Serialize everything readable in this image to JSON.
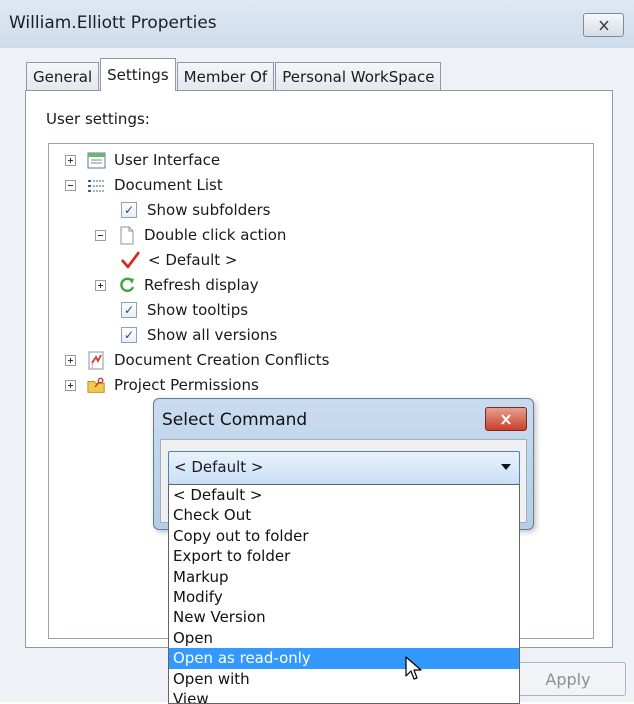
{
  "window": {
    "title": "William.Elliott Properties",
    "close_icon": "close-icon",
    "tabs": [
      {
        "label": "General",
        "active": false
      },
      {
        "label": "Settings",
        "active": true
      },
      {
        "label": "Member Of",
        "active": false
      },
      {
        "label": "Personal WorkSpace",
        "active": false
      }
    ],
    "apply_label": "Apply"
  },
  "settings": {
    "label": "User settings:",
    "tree": [
      {
        "label": "User Interface",
        "icon": "window-icon",
        "expander": "plus"
      },
      {
        "label": "Document List",
        "icon": "list-icon",
        "expander": "minus"
      },
      {
        "label": "Show subfolders",
        "checked": true
      },
      {
        "label": "Double click action",
        "icon": "document-icon",
        "expander": "minus"
      },
      {
        "label": "< Default >",
        "icon": "checkmark-icon"
      },
      {
        "label": "Refresh display",
        "icon": "refresh-icon",
        "expander": "plus"
      },
      {
        "label": "Show tooltips",
        "checked": true
      },
      {
        "label": "Show all versions",
        "checked": true
      },
      {
        "label": "Document Creation Conflicts",
        "icon": "conflict-icon",
        "expander": "plus"
      },
      {
        "label": "Project Permissions",
        "icon": "folder-key-icon",
        "expander": "plus"
      }
    ]
  },
  "dialog": {
    "title": "Select Command",
    "selected_value": "< Default >",
    "options": [
      "< Default >",
      "Check Out",
      "Copy out to folder",
      "Export to folder",
      "Markup",
      "Modify",
      "New Version",
      "Open",
      "Open as read-only",
      "Open with",
      "View"
    ],
    "highlighted": "Open as read-only",
    "colors": {
      "highlight": "#3399ff",
      "close_button": "#c8402a"
    }
  }
}
